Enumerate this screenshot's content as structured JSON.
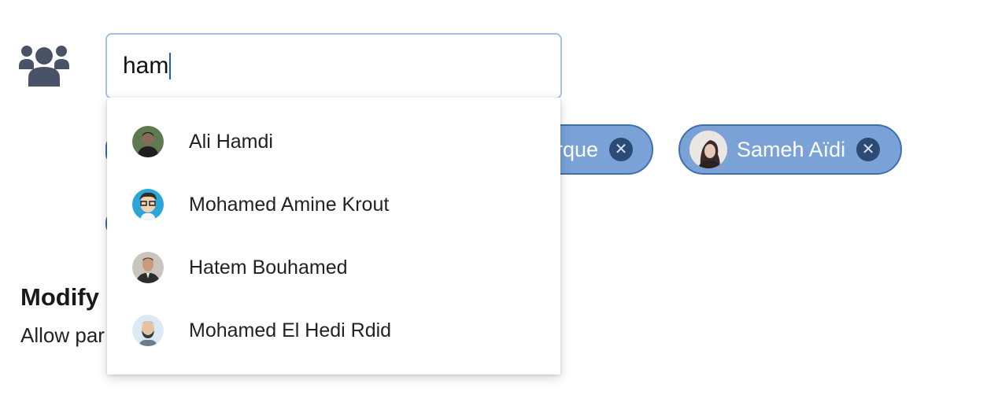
{
  "participants_field": {
    "icon": "people-group-icon",
    "search_value": "ham"
  },
  "selected_chips": [
    {
      "label": "rque",
      "avatar": "person-avatar"
    },
    {
      "label": "Sameh Aïdi",
      "avatar": "person-avatar"
    }
  ],
  "suggestions": [
    {
      "name": "Ali Hamdi",
      "avatar": "photo-avatar"
    },
    {
      "name": "Mohamed Amine Krout",
      "avatar": "cartoon-avatar"
    },
    {
      "name": "Hatem Bouhamed",
      "avatar": "photo-avatar"
    },
    {
      "name": "Mohamed El Hedi Rdid",
      "avatar": "cartoon-avatar"
    }
  ],
  "section": {
    "title": "Modify",
    "description": "Allow par"
  },
  "colors": {
    "chip_bg": "#7aa2d6",
    "chip_border": "#3f6fae",
    "input_border": "#a9bfdc",
    "icon_gray": "#4a5266"
  }
}
